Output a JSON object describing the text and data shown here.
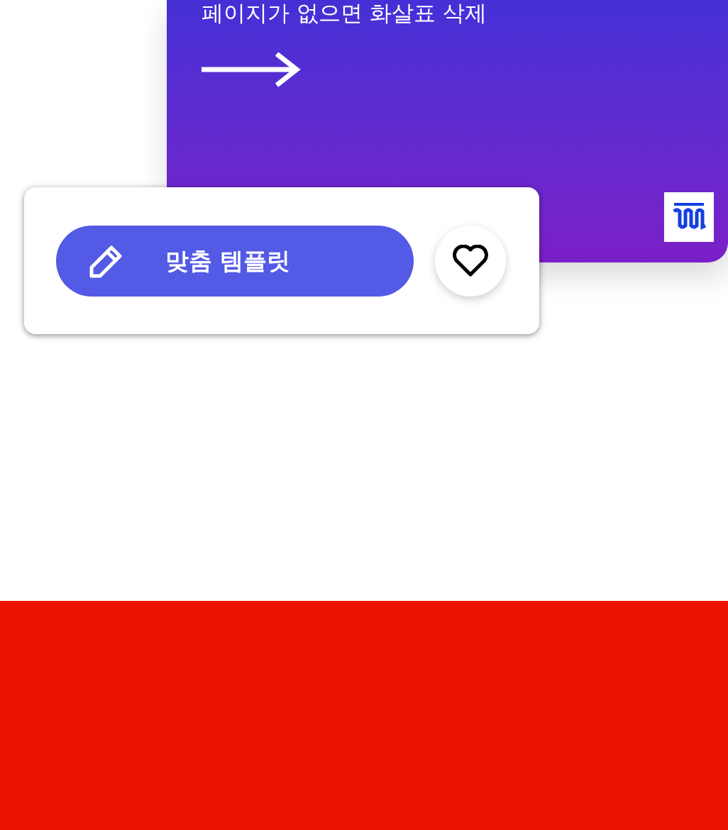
{
  "promo_card": {
    "caption": "페이지가 없으면 화살표 삭제"
  },
  "action_card": {
    "button": {
      "label": "맞춤 템플릿"
    },
    "favorite": {
      "selected": false
    }
  }
}
